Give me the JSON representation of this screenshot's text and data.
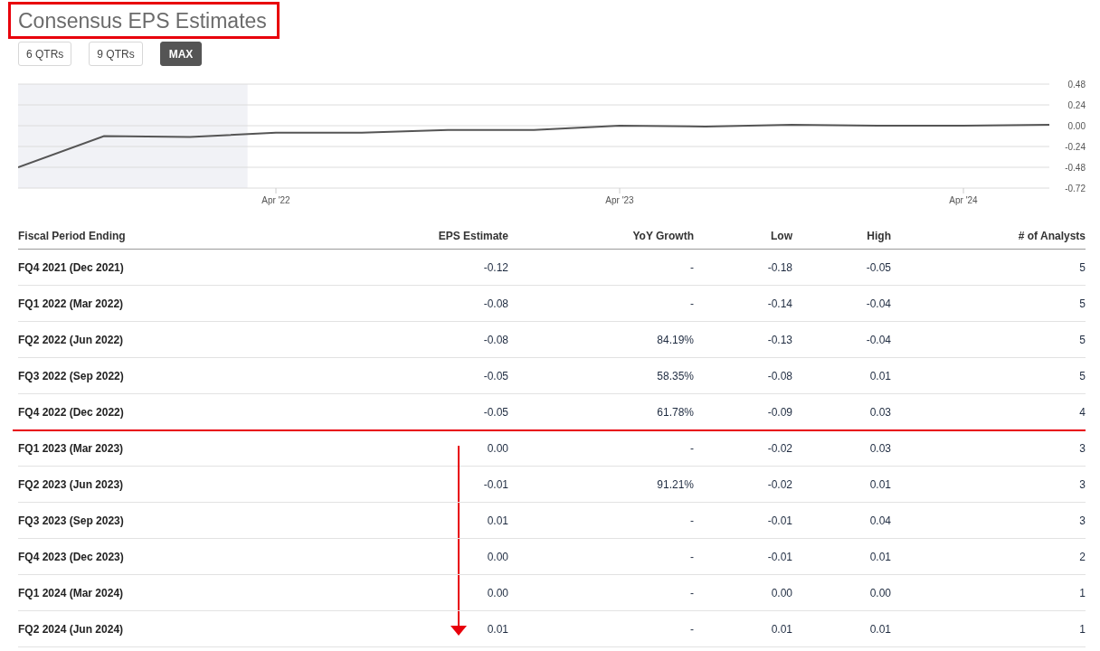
{
  "title": {
    "text": "Consensus EPS Estimates",
    "highlighted": true
  },
  "range_buttons": [
    {
      "label": "6 QTRs",
      "selected": false
    },
    {
      "label": "9 QTRs",
      "selected": false
    },
    {
      "label": "MAX",
      "selected": true
    }
  ],
  "chart_data": {
    "type": "line",
    "categories": [
      null,
      null,
      null,
      "Apr '22",
      null,
      null,
      null,
      "Apr '23",
      null,
      null,
      null,
      "Apr '24",
      null
    ],
    "series": [
      {
        "color": "#555555",
        "values": [
          -0.48,
          -0.12,
          -0.13,
          -0.08,
          -0.08,
          -0.05,
          -0.05,
          0.0,
          -0.01,
          0.01,
          0.0,
          0.0,
          0.01
        ]
      }
    ],
    "ylim": [
      -0.72,
      0.48
    ],
    "yticks": [
      {
        "value": 0.48,
        "label": "0.48"
      },
      {
        "value": 0.24,
        "label": "0.24"
      },
      {
        "value": 0,
        "label": "0.00"
      },
      {
        "value": -0.24,
        "label": "-0.24"
      },
      {
        "value": -0.48,
        "label": "-0.48"
      },
      {
        "value": -0.72,
        "label": "-0.72"
      }
    ],
    "grid": true
  },
  "history_shaded": true,
  "table": {
    "columns": [
      "Fiscal Period Ending",
      "EPS Estimate",
      "YoY Growth",
      "Low",
      "High",
      "# of Analysts"
    ],
    "rows": [
      {
        "cells": [
          "FQ4 2021 (Dec 2021)",
          "-0.12",
          "-",
          "-0.18",
          "-0.05",
          "5"
        ],
        "underlined": false,
        "arrow_from": false
      },
      {
        "cells": [
          "FQ1 2022 (Mar 2022)",
          "-0.08",
          "-",
          "-0.14",
          "-0.04",
          "5"
        ],
        "underlined": false,
        "arrow_from": false
      },
      {
        "cells": [
          "FQ2 2022 (Jun 2022)",
          "-0.08",
          "84.19%",
          "-0.13",
          "-0.04",
          "5"
        ],
        "underlined": false,
        "arrow_from": false
      },
      {
        "cells": [
          "FQ3 2022 (Sep 2022)",
          "-0.05",
          "58.35%",
          "-0.08",
          "0.01",
          "5"
        ],
        "underlined": false,
        "arrow_from": false
      },
      {
        "cells": [
          "FQ4 2022 (Dec 2022)",
          "-0.05",
          "61.78%",
          "-0.09",
          "0.03",
          "4"
        ],
        "underlined": true,
        "arrow_from": false
      },
      {
        "cells": [
          "FQ1 2023 (Mar 2023)",
          "0.00",
          "-",
          "-0.02",
          "0.03",
          "3"
        ],
        "underlined": false,
        "arrow_from": true
      },
      {
        "cells": [
          "FQ2 2023 (Jun 2023)",
          "-0.01",
          "91.21%",
          "-0.02",
          "0.01",
          "3"
        ],
        "underlined": false,
        "arrow_from": false
      },
      {
        "cells": [
          "FQ3 2023 (Sep 2023)",
          "0.01",
          "-",
          "-0.01",
          "0.04",
          "3"
        ],
        "underlined": false,
        "arrow_from": false
      },
      {
        "cells": [
          "FQ4 2023 (Dec 2023)",
          "0.00",
          "-",
          "-0.01",
          "0.01",
          "2"
        ],
        "underlined": false,
        "arrow_from": false
      },
      {
        "cells": [
          "FQ1 2024 (Mar 2024)",
          "0.00",
          "-",
          "0.00",
          "0.00",
          "1"
        ],
        "underlined": false,
        "arrow_from": false
      },
      {
        "cells": [
          "FQ2 2024 (Jun 2024)",
          "0.01",
          "-",
          "0.01",
          "0.01",
          "1"
        ],
        "underlined": false,
        "arrow_from": false
      }
    ]
  }
}
